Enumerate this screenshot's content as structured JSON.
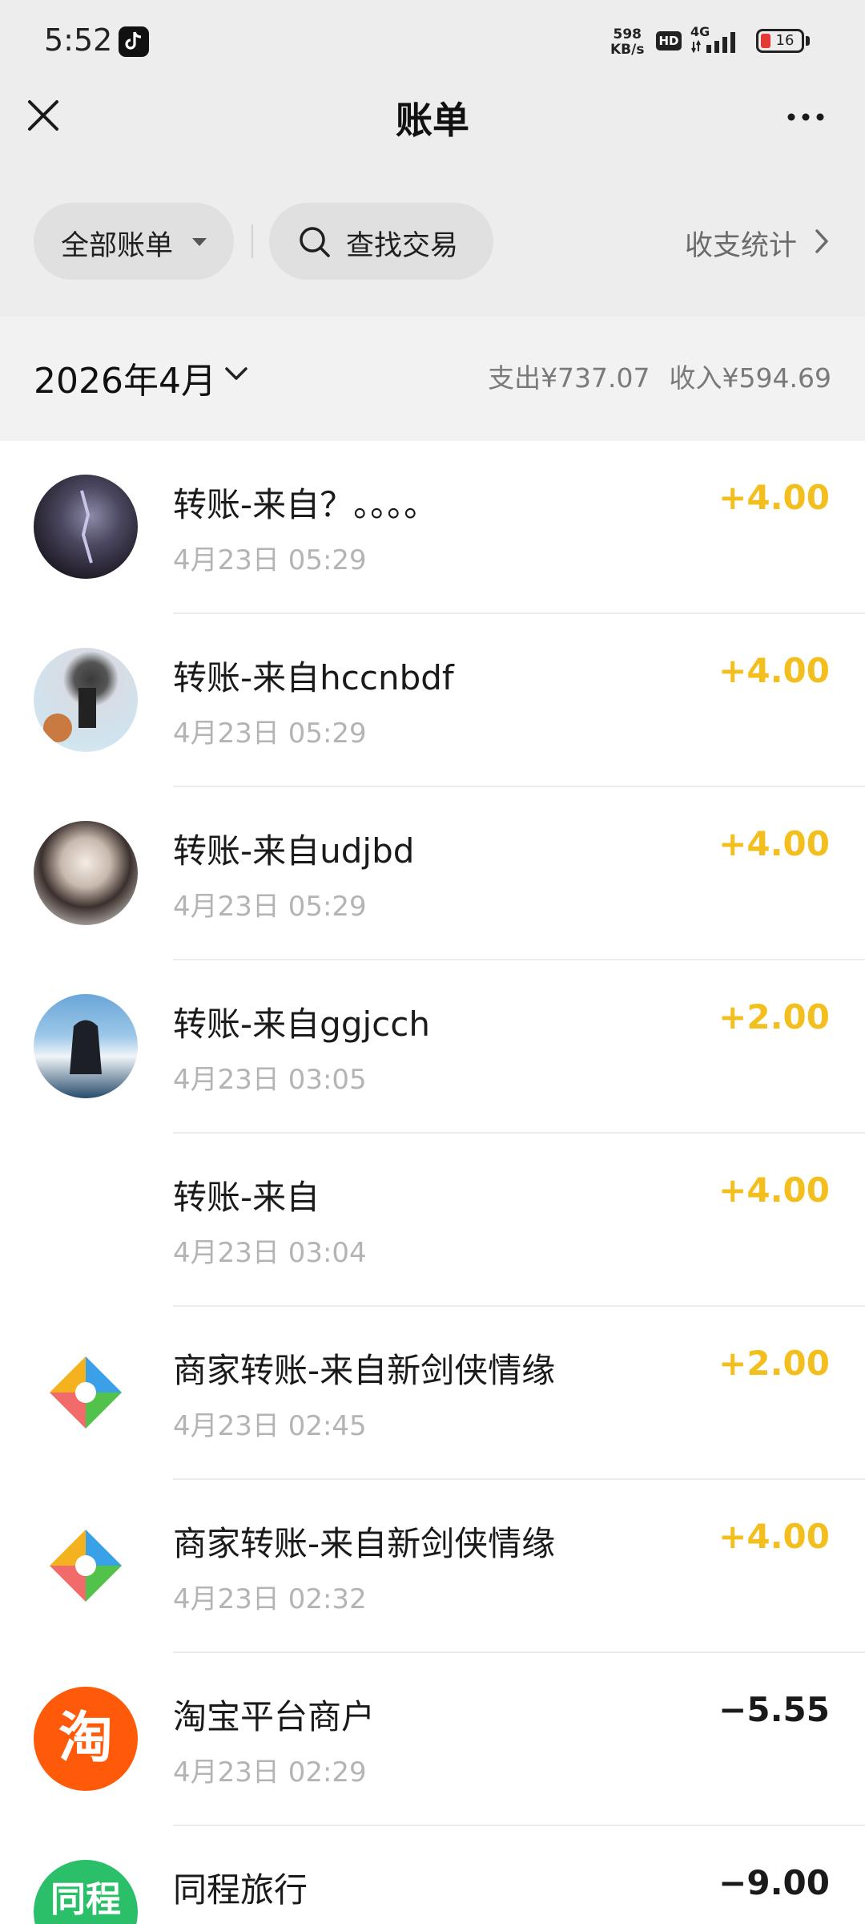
{
  "status_bar": {
    "time": "5:52",
    "net_speed_value": "598",
    "net_speed_unit": "KB/s",
    "hd_badge": "HD",
    "network": "4G",
    "battery_level": "16"
  },
  "header": {
    "title": "账单",
    "close_icon": "close-icon",
    "more_icon": "more-icon"
  },
  "filters": {
    "all_bills": "全部账单",
    "search": "查找交易",
    "stats": "收支统计"
  },
  "month": {
    "label": "2026年4月",
    "expense": "支出¥737.07",
    "income": "收入¥594.69"
  },
  "transactions": [
    {
      "title": "转账-来自？。。。。",
      "time": "4月23日 05:29",
      "amount": "+4.00",
      "direction": "in"
    },
    {
      "title": "转账-来自hccnbdf",
      "time": "4月23日 05:29",
      "amount": "+4.00",
      "direction": "in"
    },
    {
      "title": "转账-来自udjbd",
      "time": "4月23日 05:29",
      "amount": "+4.00",
      "direction": "in"
    },
    {
      "title": "转账-来自ggjcch",
      "time": "4月23日 03:05",
      "amount": "+2.00",
      "direction": "in"
    },
    {
      "title": "转账-来自",
      "time": "4月23日 03:04",
      "amount": "+4.00",
      "direction": "in"
    },
    {
      "title": "商家转账-来自新剑侠情缘",
      "time": "4月23日 02:45",
      "amount": "+2.00",
      "direction": "in"
    },
    {
      "title": "商家转账-来自新剑侠情缘",
      "time": "4月23日 02:32",
      "amount": "+4.00",
      "direction": "in"
    },
    {
      "title": "淘宝平台商户",
      "time": "4月23日 02:29",
      "amount": "−5.55",
      "direction": "out",
      "logo_text": "淘"
    },
    {
      "title": "同程旅行",
      "time": "",
      "amount": "−9.00",
      "direction": "out",
      "logo_text": "同程"
    }
  ],
  "colors": {
    "income": "#f3bf1e",
    "expense": "#1a1a1a",
    "taobao": "#ff5a0a",
    "tongcheng": "#2bbf6a",
    "top_background": "#ededed"
  }
}
